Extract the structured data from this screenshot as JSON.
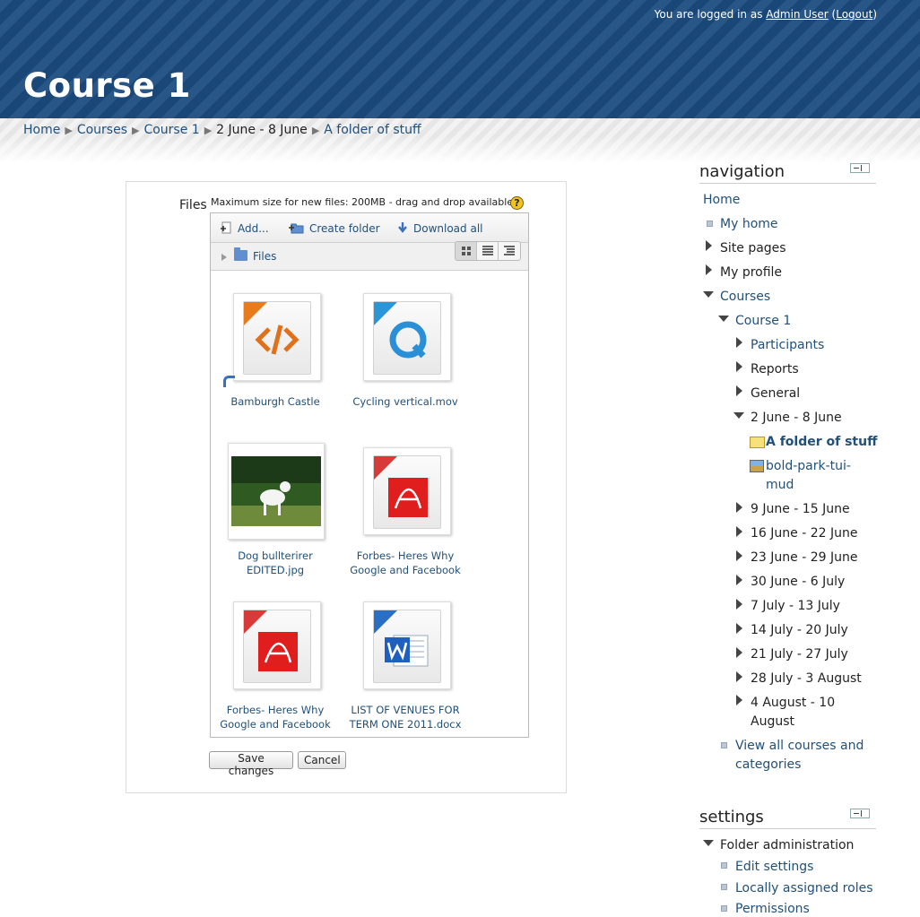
{
  "header": {
    "login_prefix": "You are logged in as",
    "user_name": "Admin User",
    "logout_label": "Logout",
    "page_title": "Course 1"
  },
  "breadcrumb": [
    "Home",
    "Courses",
    "Course 1",
    "2 June - 8 June",
    "A folder of stuff"
  ],
  "form": {
    "files_label": "Files",
    "max_size_text": "Maximum size for new files: 200MB - drag and drop available",
    "help_glyph": "?",
    "toolbar": {
      "add": "Add...",
      "create_folder": "Create folder",
      "download_all": "Download all"
    },
    "path_label": "Files",
    "files": [
      {
        "name": "Bamburgh Castle",
        "icon": "html-file-icon",
        "badge": "HTML"
      },
      {
        "name": "Cycling vertical.mov",
        "icon": "quicktime-file-icon",
        "badge": "MOV"
      },
      {
        "name": "Dog bullterirer EDITED.jpg",
        "icon": "image-thumbnail"
      },
      {
        "name": "Forbes- Heres Why Google and Facebook",
        "icon": "pdf-file-icon",
        "badge": "PDF"
      },
      {
        "name": "Forbes- Heres Why Google and Facebook",
        "icon": "pdf-file-icon",
        "badge": "PDF"
      },
      {
        "name": "LIST OF VENUES FOR TERM ONE 2011.docx",
        "icon": "word-file-icon",
        "badge": "DOCX"
      }
    ],
    "save_label": "Save changes",
    "cancel_label": "Cancel"
  },
  "navigation": {
    "title": "navigation",
    "home": "Home",
    "my_home": "My home",
    "site_pages": "Site pages",
    "my_profile": "My profile",
    "courses": "Courses",
    "course1": "Course 1",
    "participants": "Participants",
    "reports": "Reports",
    "general": "General",
    "week_current": "2 June - 8 June",
    "folder": "A folder of stuff",
    "image_res_1": "bold-park-tui-",
    "image_res_2": "mud",
    "weeks": [
      "9 June - 15 June",
      "16 June - 22 June",
      "23 June - 29 June",
      "30 June - 6 July",
      "7 July - 13 July",
      "14 July - 20 July",
      "21 July - 27 July",
      "28 July - 3 August"
    ],
    "week_last_1": "4 August - 10",
    "week_last_2": "August",
    "view_all_1": "View all courses and",
    "view_all_2": "categories"
  },
  "settings": {
    "title": "settings",
    "folder_admin": "Folder administration",
    "edit": "Edit settings",
    "roles": "Locally assigned roles",
    "permissions": "Permissions"
  }
}
